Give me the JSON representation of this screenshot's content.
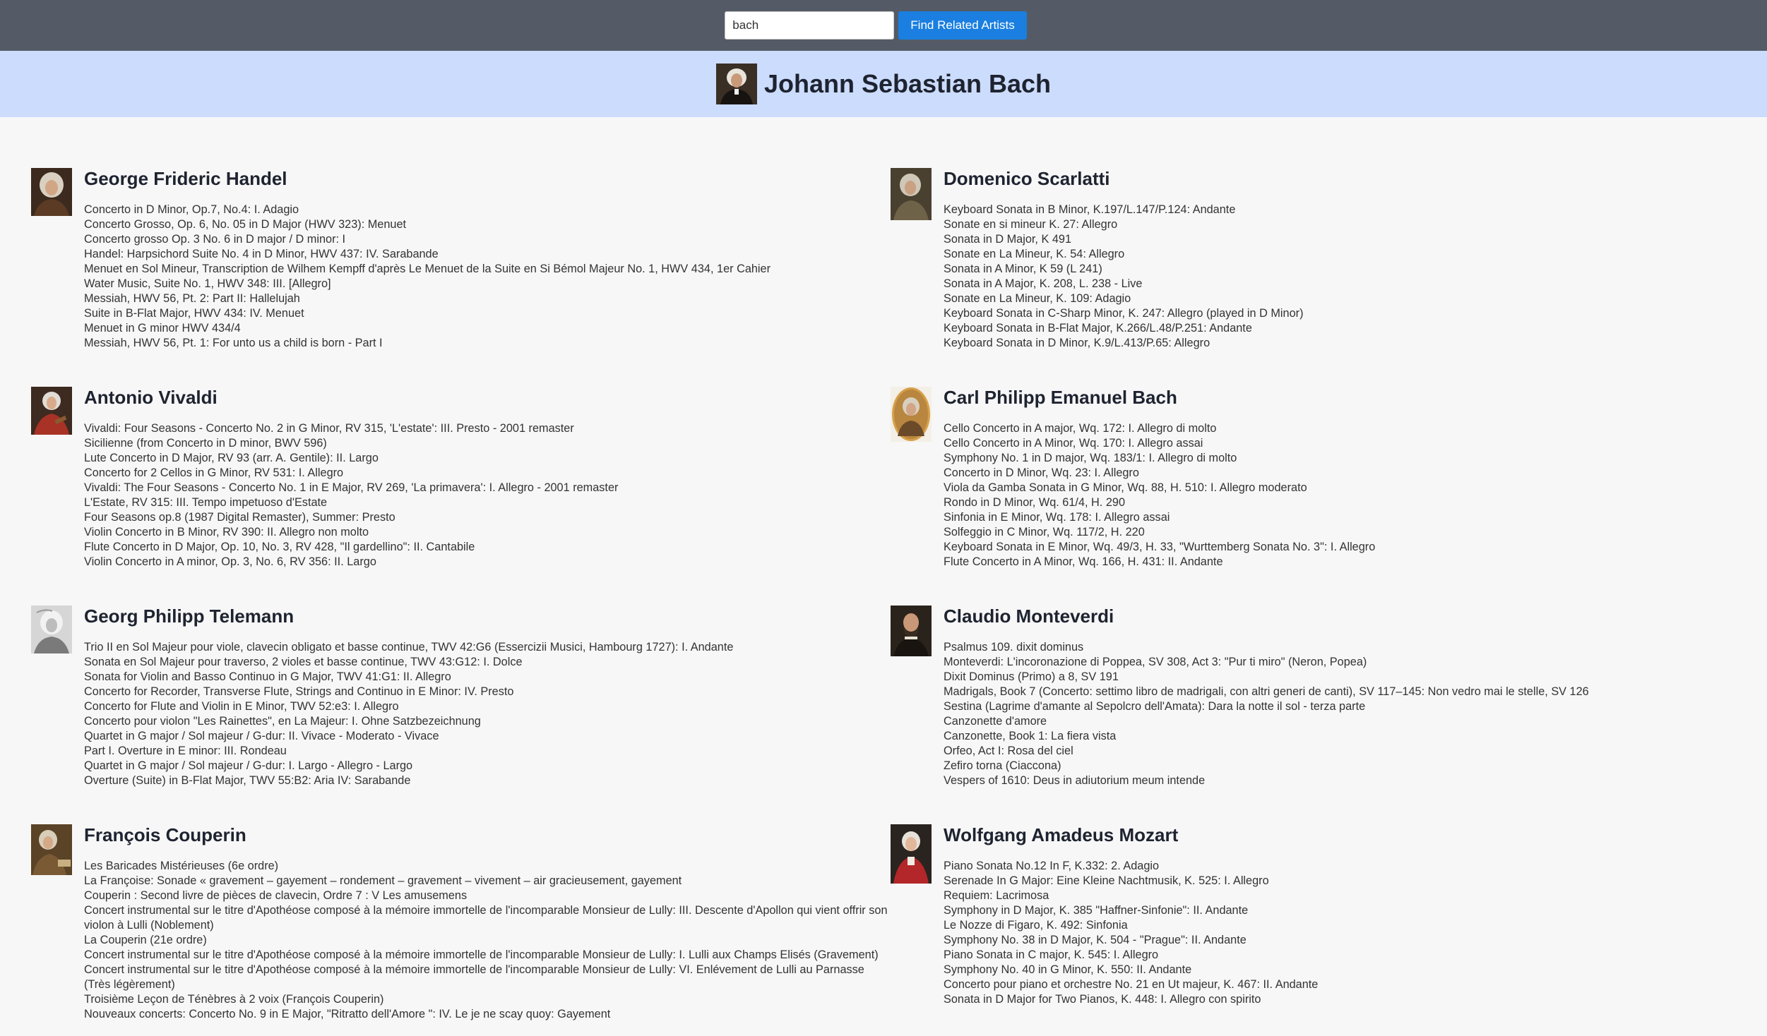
{
  "search": {
    "value": "bach",
    "button_label": "Find Related Artists"
  },
  "main_artist": {
    "name": "Johann Sebastian Bach",
    "portrait_icon": "bach-portrait"
  },
  "related_artists": [
    {
      "name": "George Frideric Handel",
      "portrait_icon": "handel-portrait",
      "tracks": [
        "Concerto in D Minor, Op.7, No.4: I. Adagio",
        "Concerto Grosso, Op. 6, No. 05 in D Major (HWV 323): Menuet",
        "Concerto grosso Op. 3 No. 6 in D major / D minor: I",
        "Handel: Harpsichord Suite No. 4 in D Minor, HWV 437: IV. Sarabande",
        "Menuet en Sol Mineur, Transcription de Wilhem Kempff d'après Le Menuet de la Suite en Si Bémol Majeur No. 1, HWV 434, 1er Cahier",
        "Water Music, Suite No. 1, HWV 348: III. [Allegro]",
        "Messiah, HWV 56, Pt. 2: Part II: Hallelujah",
        "Suite in B-Flat Major, HWV 434: IV. Menuet",
        "Menuet in G minor HWV 434/4",
        "Messiah, HWV 56, Pt. 1: For unto us a child is born - Part I"
      ]
    },
    {
      "name": "Domenico Scarlatti",
      "portrait_icon": "scarlatti-portrait",
      "tracks": [
        "Keyboard Sonata in B Minor, K.197/L.147/P.124: Andante",
        "Sonate en si mineur K. 27: Allegro",
        "Sonata in D Major, K 491",
        "Sonate en La Mineur, K. 54: Allegro",
        "Sonata in A Minor, K 59 (L 241)",
        "Sonata in A Major, K. 208, L. 238 - Live",
        "Sonate en La Mineur, K. 109: Adagio",
        "Keyboard Sonata in C-Sharp Minor, K. 247: Allegro (played in D Minor)",
        "Keyboard Sonata in B-Flat Major, K.266/L.48/P.251: Andante",
        "Keyboard Sonata in D Minor, K.9/L.413/P.65: Allegro"
      ]
    },
    {
      "name": "Antonio Vivaldi",
      "portrait_icon": "vivaldi-portrait",
      "tracks": [
        "Vivaldi: Four Seasons - Concerto No. 2 in G Minor, RV 315, 'L'estate': III. Presto - 2001 remaster",
        "Sicilienne (from Concerto in D minor, BWV 596)",
        "Lute Concerto in D Major, RV 93 (arr. A. Gentile): II. Largo",
        "Concerto for 2 Cellos in G Minor, RV 531: I. Allegro",
        "Vivaldi: The Four Seasons - Concerto No. 1 in E Major, RV 269, 'La primavera': I. Allegro - 2001 remaster",
        "L'Estate, RV 315: III. Tempo impetuoso d'Estate",
        "Four Seasons op.8 (1987 Digital Remaster), Summer: Presto",
        "Violin Concerto in B Minor, RV 390: II. Allegro non molto",
        "Flute Concerto in D Major, Op. 10, No. 3, RV 428, \"Il gardellino\": II. Cantabile",
        "Violin Concerto in A minor, Op. 3, No. 6, RV 356: II. Largo"
      ]
    },
    {
      "name": "Carl Philipp Emanuel Bach",
      "portrait_icon": "cpe-bach-portrait",
      "tracks": [
        "Cello Concerto in A major, Wq. 172: I. Allegro di molto",
        "Cello Concerto in A Minor, Wq. 170: I. Allegro assai",
        "Symphony No. 1 in D major, Wq. 183/1: I. Allegro di molto",
        "Concerto in D Minor, Wq. 23: I. Allegro",
        "Viola da Gamba Sonata in G Minor, Wq. 88, H. 510: I. Allegro moderato",
        "Rondo in D Minor, Wq. 61/4, H. 290",
        "Sinfonia in E Minor, Wq. 178: I. Allegro assai",
        "Solfeggio in C Minor, Wq. 117/2, H. 220",
        "Keyboard Sonata in E Minor, Wq. 49/3, H. 33, \"Wurttemberg Sonata No. 3\": I. Allegro",
        "Flute Concerto in A Minor, Wq. 166, H. 431: II. Andante"
      ]
    },
    {
      "name": "Georg Philipp Telemann",
      "portrait_icon": "telemann-portrait",
      "tracks": [
        "Trio II en Sol Majeur pour viole, clavecin obligato et basse continue, TWV 42:G6 (Essercizii Musici, Hambourg 1727): I. Andante",
        "Sonata en Sol Majeur pour traverso, 2 violes et basse continue, TWV 43:G12: I. Dolce",
        "Sonata for Violin and Basso Continuo in G Major, TWV 41:G1: II. Allegro",
        "Concerto for Recorder, Transverse Flute, Strings and Continuo in E Minor: IV. Presto",
        "Concerto for Flute and Violin in E Minor, TWV 52:e3: I. Allegro",
        "Concerto pour violon \"Les Rainettes\", en La Majeur: I. Ohne Satzbezeichnung",
        "Quartet in G major / Sol majeur / G-dur: II. Vivace - Moderato - Vivace",
        "Part I. Overture in E minor: III. Rondeau",
        "Quartet in G major / Sol majeur / G-dur: I. Largo - Allegro - Largo",
        "Overture (Suite) in B-Flat Major, TWV 55:B2: Aria IV: Sarabande"
      ]
    },
    {
      "name": "Claudio Monteverdi",
      "portrait_icon": "monteverdi-portrait",
      "tracks": [
        "Psalmus 109. dixit dominus",
        "Monteverdi: L'incoronazione di Poppea, SV 308, Act 3: \"Pur ti miro\" (Neron, Popea)",
        "Dixit Dominus (Primo) a 8, SV 191",
        "Madrigals, Book 7 (Concerto: settimo libro de madrigali, con altri generi de canti), SV 117–145: Non vedro mai le stelle, SV 126",
        "Sestina (Lagrime d'amante al Sepolcro dell'Amata): Dara la notte il sol - terza parte",
        "Canzonette d'amore",
        "Canzonette, Book 1: La fiera vista",
        "Orfeo, Act I: Rosa del ciel",
        "Zefiro torna (Ciaccona)",
        "Vespers of 1610: Deus in adiutorium meum intende"
      ]
    },
    {
      "name": "François Couperin",
      "portrait_icon": "couperin-portrait",
      "tracks": [
        "Les Baricades Mistérieuses (6e ordre)",
        "La Françoise: Sonade « gravement – gayement – rondement – gravement – vivement – air gracieusement, gayement",
        "Couperin : Second livre de pièces de clavecin, Ordre 7 : V Les amusemens",
        "Concert instrumental sur le titre d'Apothéose composé à la mémoire immortelle de l'incomparable Monsieur de Lully: III. Descente d'Apollon qui vient offrir son violon à Lulli (Noblement)",
        "La Couperin (21e ordre)",
        "Concert instrumental sur le titre d'Apothéose composé à la mémoire immortelle de l'incomparable Monsieur de Lully: I. Lulli aux Champs Elisés (Gravement)",
        "Concert instrumental sur le titre d'Apothéose composé à la mémoire immortelle de l'incomparable Monsieur de Lully: VI. Enlévement de Lulli au Parnasse (Très légèrement)",
        "Troisième Leçon de Ténèbres à 2 voix (François Couperin)",
        "Nouveaux concerts: Concerto No. 9 in E Major, \"Ritratto dell'Amore \": IV. Le je ne scay quoy: Gayement"
      ]
    },
    {
      "name": "Wolfgang Amadeus Mozart",
      "portrait_icon": "mozart-portrait",
      "tracks": [
        "Piano Sonata No.12 In F, K.332: 2. Adagio",
        "Serenade In G Major: Eine Kleine Nachtmusik, K. 525: I. Allegro",
        "Requiem: Lacrimosa",
        "Symphony in D Major, K. 385 \"Haffner-Sinfonie\": II. Andante",
        "Le Nozze di Figaro, K. 492: Sinfonia",
        "Symphony No. 38 in D Major, K. 504 - \"Prague\": II. Andante",
        "Piano Sonata in C major, K. 545: I. Allegro",
        "Symphony No. 40 in G Minor, K. 550: II. Andante",
        "Concerto pour piano et orchestre No. 21 en Ut majeur, K. 467: II. Andante",
        "Sonata in D Major for Two Pianos, K. 448: I. Allegro con spirito"
      ]
    }
  ]
}
